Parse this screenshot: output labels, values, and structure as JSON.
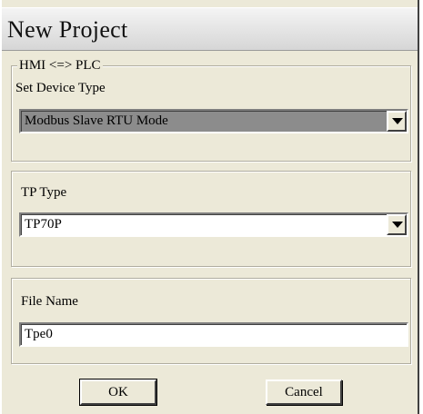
{
  "window": {
    "title": "New Project"
  },
  "connection_group": {
    "legend": "HMI <=> PLC",
    "device_type_label": "Set Device Type",
    "device_type_value": "Modbus Slave RTU Mode"
  },
  "tp_group": {
    "label": "TP Type",
    "value": "TP70P"
  },
  "file_group": {
    "label": "File Name",
    "value": "Tpe0"
  },
  "buttons": {
    "ok_label": "OK",
    "cancel_label": "Cancel"
  },
  "icons": {
    "dropdown": "chevron-down-icon"
  }
}
